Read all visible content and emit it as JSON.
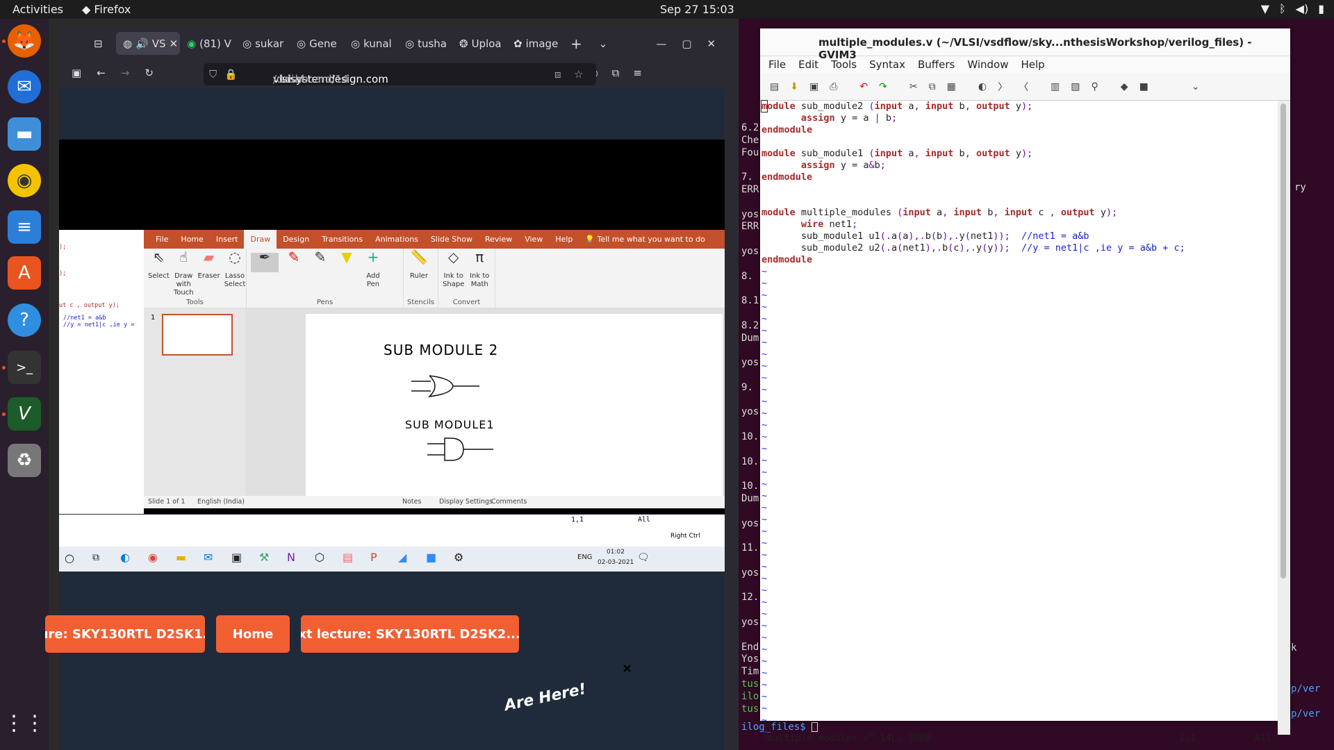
{
  "topbar": {
    "activities": "Activities",
    "app": "Firefox",
    "clock": "Sep 27  15:03"
  },
  "dock": {
    "icons": [
      "firefox-icon",
      "thunderbird-icon",
      "files-icon",
      "rhythmbox-icon",
      "writer-icon",
      "software-icon",
      "help-icon",
      "terminal-icon",
      "vim-icon",
      "trash-icon",
      "app-grid-icon"
    ]
  },
  "firefox": {
    "tabs": [
      {
        "label": "VS"
      },
      {
        "label": "(81) V"
      },
      {
        "label": "sukar"
      },
      {
        "label": "Gene"
      },
      {
        "label": "kunal"
      },
      {
        "label": "tusha"
      },
      {
        "label": "Uploa"
      },
      {
        "label": "image"
      }
    ],
    "url_host": "vsdiat.",
    "url_domain": "vlsisystemdesign.com",
    "url_path": "/dashboard/14",
    "prev_lecture": "ture: SKY130RTL D2SK1...",
    "home": "Home",
    "next_lecture": "Next lecture: SKY130RTL D2SK2...",
    "arrow": "→",
    "close": "×",
    "badge": "Are Here!"
  },
  "ppt": {
    "tabs": [
      "File",
      "Home",
      "Insert",
      "Draw",
      "Design",
      "Transitions",
      "Animations",
      "Slide Show",
      "Review",
      "View",
      "Help"
    ],
    "tell_me": "Tell me what you want to do",
    "tools": [
      {
        "label": "Select"
      },
      {
        "label": "Draw with Touch"
      },
      {
        "label": "Eraser"
      },
      {
        "label": "Lasso Select"
      }
    ],
    "group_tools": "Tools",
    "group_pens": "Pens",
    "add_pen": "Add Pen",
    "ruler": "Ruler",
    "group_stencils": "Stencils",
    "ink_shape": "Ink to Shape",
    "ink_math": "Ink to Math",
    "group_convert": "Convert",
    "slide_num": "1",
    "slide_text1": "SUB MODULE 2",
    "slide_text2": "SUB MODULE1",
    "status_slide": "Slide 1 of 1",
    "status_lang": "English (India)",
    "status_notes": "Notes",
    "status_display": "Display Settings",
    "status_comments": "Comments",
    "left_snip1": "ut c , output y);",
    "left_snip2": "//net1 = a&b",
    "left_snip3": "//y = net1|c ,ie y =",
    "right_ctrl": "Right Ctrl",
    "pos": "1,1",
    "all": "All",
    "win_lang": "ENG",
    "win_time": "01:02",
    "win_date": "02-03-2021"
  },
  "gvim": {
    "title": "multiple_modules.v (~/VLSI/vsdflow/sky...nthesisWorkshop/verilog_files) - GVIM3",
    "menu": [
      "File",
      "Edit",
      "Tools",
      "Syntax",
      "Buffers",
      "Window",
      "Help"
    ],
    "status_file": "\"multiple_modules.v\" 14L, 366B",
    "status_pos": "1,1",
    "status_all": "All"
  },
  "terminal": {
    "left": [
      "6.2",
      "Che",
      "Fou",
      "",
      "7.",
      "ERR",
      "",
      "yos",
      "ERR",
      "",
      "yos",
      "",
      "8.",
      "",
      "8.1",
      "",
      "8.2",
      "Dum",
      "",
      "yos",
      "",
      "9.",
      "",
      "yos",
      "",
      "10.",
      "",
      "10.",
      "",
      "10.",
      "Dum",
      "",
      "yos",
      "",
      "11.",
      "",
      "yos",
      "",
      "12.",
      "",
      "yos",
      "",
      "End",
      "Yos",
      "Tim",
      "tus",
      "ilo",
      "tus"
    ],
    "prompt": "ilog_files$",
    "right_ry": "ry",
    "right_k": "k",
    "right_ver1": "p/ver",
    "right_ver2": "p/ver"
  }
}
